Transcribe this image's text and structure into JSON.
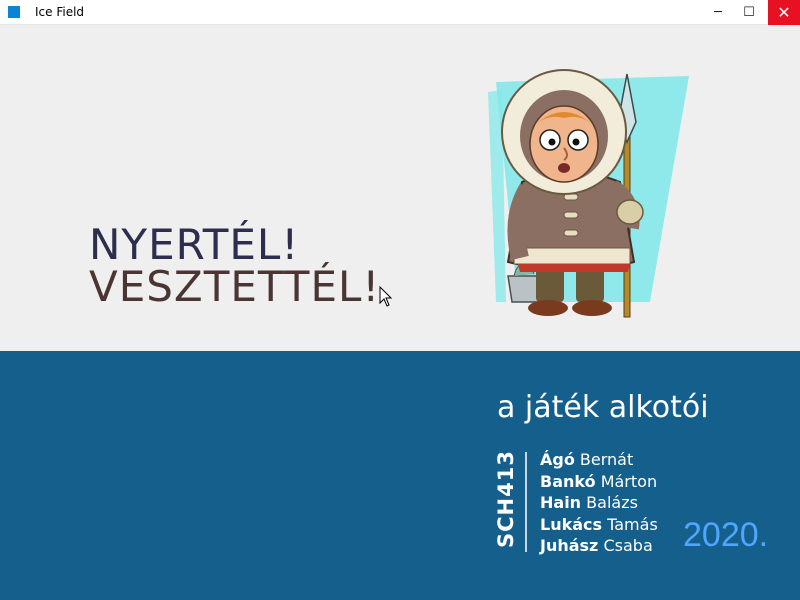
{
  "window": {
    "title": "Ice Field",
    "minimize_glyph": "─",
    "maximize_glyph": "☐",
    "close_glyph": "✕"
  },
  "result": {
    "win": "NYERTÉL!",
    "lose": "VESZTETTÉL!"
  },
  "credits": {
    "title": "a játék alkotói",
    "team": "SCH413",
    "authors": [
      {
        "last": "Ágó",
        "first": "Bernát"
      },
      {
        "last": "Bankó",
        "first": "Márton"
      },
      {
        "last": "Hain",
        "first": "Balázs"
      },
      {
        "last": "Lukács",
        "first": "Tamás"
      },
      {
        "last": "Juhász",
        "first": "Csaba"
      }
    ],
    "year": "2020."
  },
  "icons": {
    "app": "app-icon",
    "character": "eskimo-character-illustration",
    "cursor": "mouse-pointer-icon"
  },
  "colors": {
    "top_background": "#efefef",
    "bottom_background": "#155f8d",
    "win_text": "#2d2e4d",
    "lose_text": "#4b3533",
    "year": "#4fa6ff",
    "close_button": "#e81123"
  }
}
